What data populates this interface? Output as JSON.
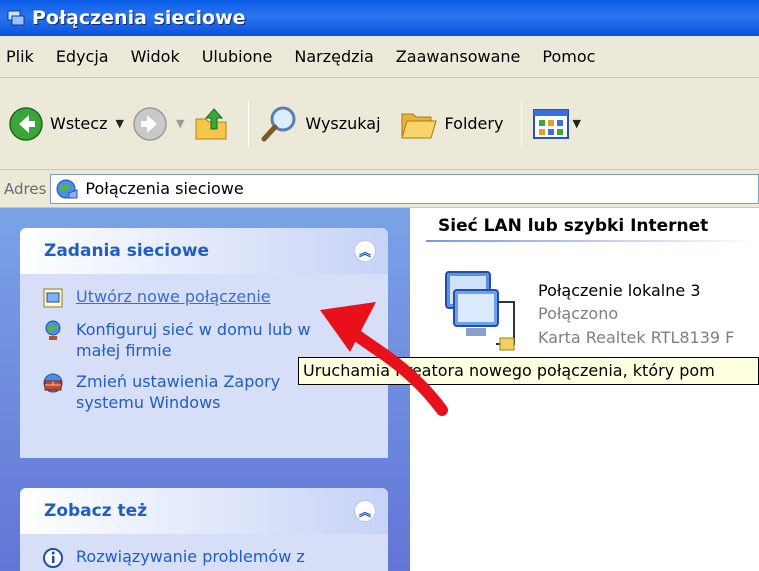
{
  "window": {
    "title": "Połączenia sieciowe"
  },
  "menu": [
    "Plik",
    "Edycja",
    "Widok",
    "Ulubione",
    "Narzędzia",
    "Zaawansowane",
    "Pomoc"
  ],
  "toolbar": {
    "back_label": "Wstecz",
    "search_label": "Wyszukaj",
    "folders_label": "Foldery",
    "dropdown_glyph": "▼"
  },
  "address": {
    "label": "Adres",
    "value": "Połączenia sieciowe"
  },
  "network_tasks": {
    "title": "Zadania sieciowe",
    "collapse_glyph": "︽",
    "items": [
      {
        "label": "Utwórz nowe połączenie",
        "icon": "new-connection-icon"
      },
      {
        "label": "Konfiguruj sieć w domu lub w małej firmie",
        "icon": "home-network-icon"
      },
      {
        "label": "Zmień ustawienia Zapory systemu Windows",
        "icon": "firewall-icon"
      }
    ]
  },
  "see_also": {
    "title": "Zobacz też",
    "collapse_glyph": "︽",
    "items": [
      {
        "label": "Rozwiązywanie problemów z",
        "icon": "info-icon"
      }
    ]
  },
  "content": {
    "group_header": "Sieć LAN lub szybki Internet",
    "connection": {
      "name": "Połączenie lokalne 3",
      "status": "Połączono",
      "adapter": "Karta Realtek RTL8139 F"
    }
  },
  "tooltip": {
    "text": "Uruchamia Kreatora nowego połączenia, który pom"
  },
  "colors": {
    "title_bar": "#0a5ce6",
    "task_pane": "#6d8ee0",
    "link": "#215dc6",
    "annotation_arrow": "#e8101a"
  }
}
